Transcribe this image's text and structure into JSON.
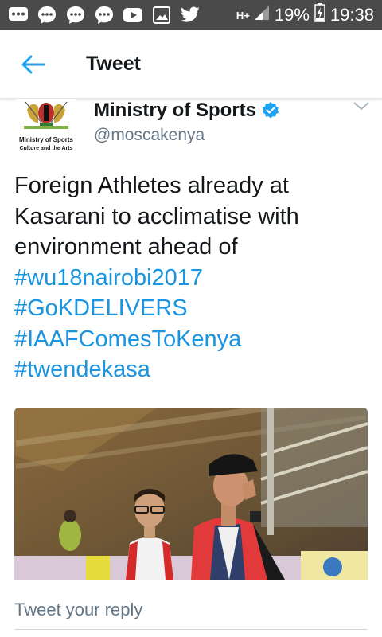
{
  "status_bar": {
    "battery_percent": "19%",
    "time": "19:38",
    "network": "H+",
    "icons": [
      "chat-icon",
      "messenger-icon",
      "messenger-icon",
      "messenger-icon",
      "youtube-icon",
      "gallery-icon",
      "twitter-icon"
    ],
    "color": "#4a4a4a"
  },
  "header": {
    "title": "Tweet",
    "back_icon": "arrow-left-icon",
    "accent": "#1da1f2"
  },
  "tweet": {
    "author_name": "Ministry of Sports",
    "handle": "@moscakenya",
    "verified": true,
    "avatar_text_1": "Ministry of Sports",
    "avatar_text_2": "Culture and the Arts",
    "text": "Foreign Athletes already at Kasarani to acclimatise with environment ahead of",
    "text_lines": [
      "Foreign Athletes already at",
      "Kasarani to acclimatise with",
      "environment ahead of"
    ],
    "hashtags": [
      "#wu18nairobi2017",
      "#GoKDELIVERS",
      "#IAAFComesToKenya",
      "#twendekasa"
    ],
    "hashtag_color": "#1b95e0",
    "media": "photo of two athletes in red and white team jackets at a stadium"
  },
  "reply": {
    "placeholder": "Tweet your reply"
  }
}
